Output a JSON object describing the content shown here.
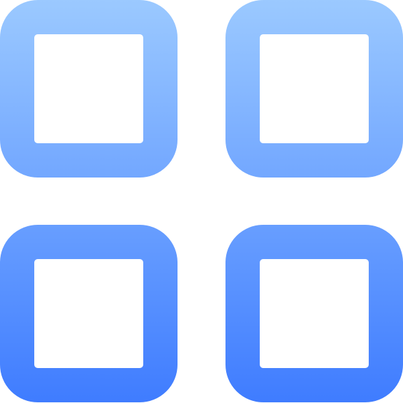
{
  "icon": {
    "name": "apps-grid-icon",
    "tiles": [
      {
        "name": "grid-tile-top-left"
      },
      {
        "name": "grid-tile-top-right"
      },
      {
        "name": "grid-tile-bottom-left"
      },
      {
        "name": "grid-tile-bottom-right"
      }
    ],
    "colors": {
      "gradient_top": "#9BC9FF",
      "gradient_bottom": "#3F7CFF"
    }
  }
}
